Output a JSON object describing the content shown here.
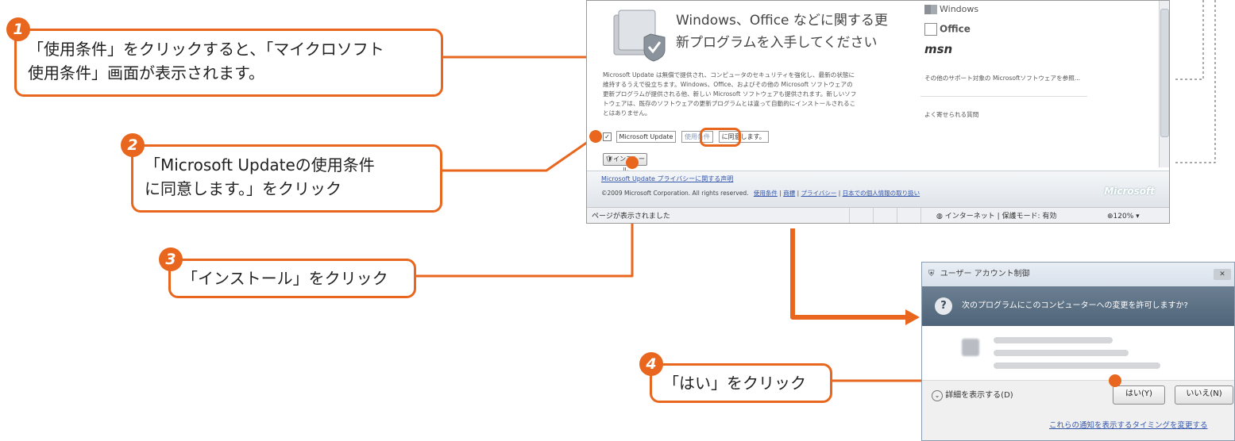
{
  "steps": [
    {
      "number": "1",
      "text_line1": "「使用条件」をクリックすると、「マイクロソフト",
      "text_line2": "使用条件」画面が表示されます。"
    },
    {
      "number": "2",
      "text_line1": "「Microsoft Updateの使用条件",
      "text_line2": "に同意します。」をクリック"
    },
    {
      "number": "3",
      "text_line1": "「インストール」をクリック"
    },
    {
      "number": "4",
      "text_line1": "「はい」をクリック"
    }
  ],
  "browser": {
    "heading_line1": "Windows、Office などに関する更",
    "heading_line2": "新プログラムを入手してください",
    "products": [
      "Windows",
      "Office",
      "msn"
    ],
    "description_lines": [
      "Microsoft Update は無償で提供され、コンピュータのセキュリティを強化し、最新の状態に",
      "維持するうえで役立ちます。Windows、Office、およびその他の Microsoft ソフトウェアの",
      "更新プログラムが提供される他、新しい Microsoft ソフトウェアも提供されます。新しいソフ",
      "トウェアは、既存のソフトウェアの更新プログラムとは違って自動的にインストールされるこ",
      "とはありません。"
    ],
    "other_software_link": "その他のサポート対象の Microsoftソフトウェアを参照...",
    "faq_link": "よく寄せられる質問",
    "checkbox_label": "Microsoft Update",
    "terms_link": "使用条件",
    "agree_text": "に同意します。",
    "install_button": "インストール",
    "privacy_link": "Microsoft Update プライバシーに関する声明",
    "copyright": "©2009 Microsoft Corporation. All rights reserved.",
    "footer_links": [
      "使用条件",
      "商標",
      "プライバシー",
      "日本での個人情報の取り扱い"
    ],
    "footer_brand": "Microsoft",
    "status_text": "ページが表示されました",
    "zone_text": "インターネット | 保護モード: 有効",
    "zoom_text": "120%"
  },
  "uac": {
    "title": "ユーザー アカウント制御",
    "question": "次のプログラムにこのコンピューターへの変更を許可しますか?",
    "details_toggle": "詳細を表示する(D)",
    "yes_button": "はい(Y)",
    "no_button": "いいえ(N)",
    "notify_link": "これらの通知を表示するタイミングを変更する"
  },
  "colors": {
    "accent": "#e8661e",
    "uac_header": "#4f6479"
  }
}
